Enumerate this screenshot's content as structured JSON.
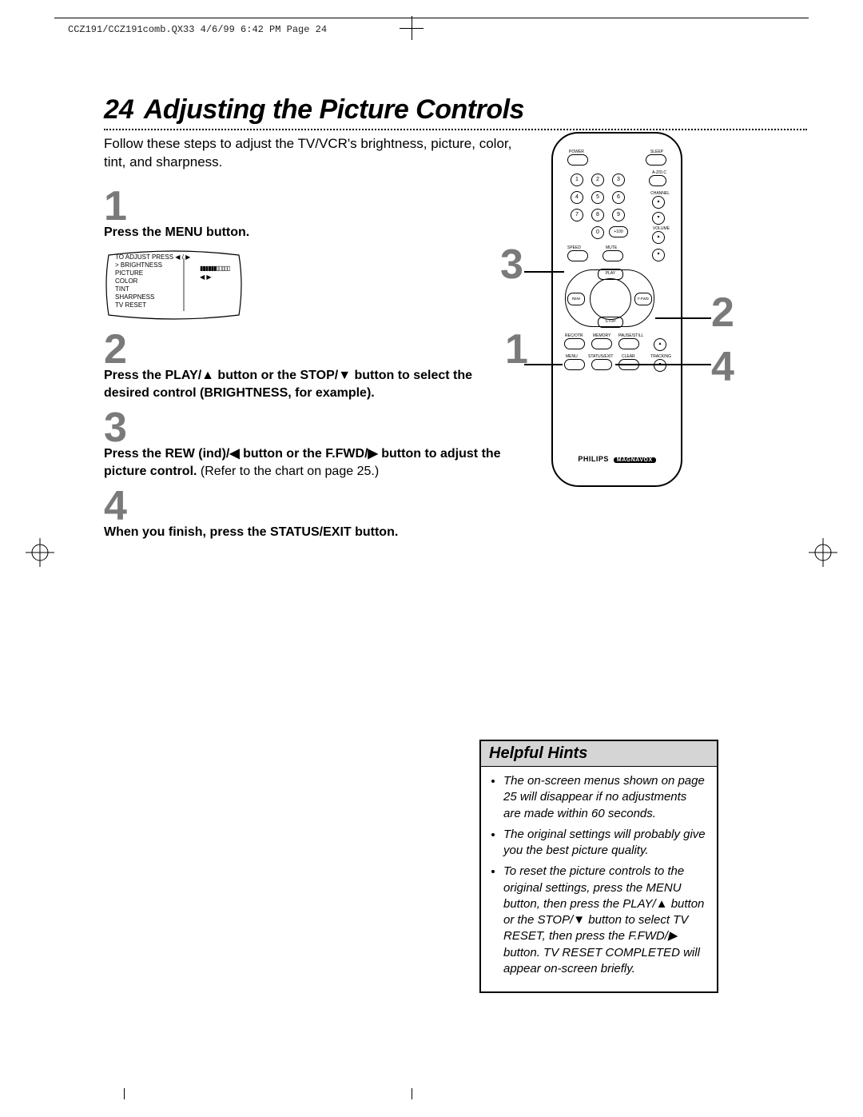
{
  "header": "CCZ191/CCZ191comb.QX33  4/6/99 6:42 PM  Page 24",
  "page_number": "24",
  "title": "Adjusting the Picture Controls",
  "intro": "Follow these steps to adjust the TV/VCR's brightness, picture, color, tint, and sharpness.",
  "steps": {
    "s1": {
      "num": "1",
      "body_bold": "Press the MENU button."
    },
    "s2": {
      "num": "2",
      "body_bold": "Press the PLAY/▲ button or the STOP/▼ button to select the desired control (BRIGHTNESS, for example)."
    },
    "s3": {
      "num": "3",
      "body_bold": "Press the REW (ind)/◀ button or the F.FWD/▶ button to adjust the picture control.",
      "body_norm": " (Refer to the chart on page 25.)"
    },
    "s4": {
      "num": "4",
      "body_bold": "When you finish, press the STATUS/EXIT button."
    }
  },
  "tv_menu": {
    "header": "TO ADJUST PRESS ◀ / ▶",
    "items": [
      "BRIGHTNESS",
      "PICTURE",
      "COLOR",
      "TINT",
      "SHARPNESS",
      "TV RESET"
    ],
    "slider": "▮▮▮▮▮▮▯▯▯▯▯",
    "arrows": "◀          ▶"
  },
  "remote": {
    "brand": "PHILIPS",
    "brand2": "MAGNAVOX",
    "labels": {
      "power": "POWER",
      "sleep": "SLEEP",
      "azdc": "A-Z/D.C",
      "channel": "CHANNEL",
      "volume": "VOLUME",
      "speed": "SPEED",
      "mute": "MUTE",
      "play": "PLAY",
      "rew": "REW",
      "ffwd": "F.FWD",
      "stop": "STOP",
      "recotr": "REC/OTR",
      "memory": "MEMORY",
      "pausestill": "PAUSE/STILL",
      "menu": "MENU",
      "statusexit": "STATUS/EXIT",
      "clear": "CLEAR",
      "tracking": "TRACKING",
      "plus100": "+100"
    },
    "keypad": [
      "1",
      "2",
      "3",
      "4",
      "5",
      "6",
      "7",
      "8",
      "9",
      "0"
    ]
  },
  "callouts": {
    "c1": "1",
    "c2": "2",
    "c3": "3",
    "c4": "4"
  },
  "hints": {
    "title": "Helpful Hints",
    "items": [
      "The on-screen menus shown on page 25 will disappear if no adjustments are made within 60 seconds.",
      "The original settings will probably give you the best picture quality.",
      "To reset the picture controls to the original settings, press the MENU button, then press the PLAY/▲ button or the STOP/▼ button to select TV RESET, then press the F.FWD/▶ button. TV RESET COMPLETED will appear on-screen briefly."
    ]
  }
}
